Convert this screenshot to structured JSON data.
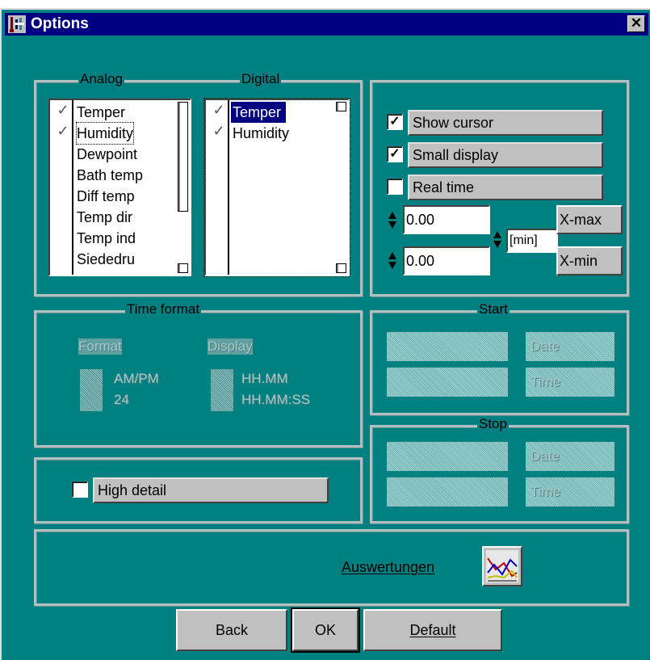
{
  "window": {
    "title": "Options",
    "close_label": "✕"
  },
  "analog": {
    "legend": "Analog",
    "items": [
      {
        "label": "Temper",
        "checked": true
      },
      {
        "label": "Humidity",
        "checked": true
      },
      {
        "label": "Dewpoint",
        "checked": false
      },
      {
        "label": "Bath temp",
        "checked": false
      },
      {
        "label": "Diff temp",
        "checked": false
      },
      {
        "label": "Temp dir",
        "checked": false
      },
      {
        "label": "Temp ind",
        "checked": false
      },
      {
        "label": "Siededru",
        "checked": false
      }
    ],
    "check_glyph": "✓"
  },
  "digital": {
    "legend": "Digital",
    "items": [
      {
        "label": "Temper",
        "checked": true,
        "selected": true
      },
      {
        "label": "Humidity",
        "checked": true,
        "selected": false
      }
    ],
    "check_glyph": "✓"
  },
  "display": {
    "show_cursor": {
      "label": "Show cursor",
      "checked": true
    },
    "small_display": {
      "label": "Small display",
      "checked": true
    },
    "real_time": {
      "label": "Real time",
      "checked": false
    },
    "x_max_value": "0.00",
    "x_min_value": "0.00",
    "unit": "[min]",
    "x_max_label": "X-max",
    "x_min_label": "X-min",
    "check_glyph": "✓"
  },
  "time_format": {
    "legend": "Time format",
    "format_label": "Format",
    "display_label": "Display",
    "format_options": [
      "AM/PM",
      "24"
    ],
    "display_options": [
      "HH.MM",
      "HH.MM:SS"
    ]
  },
  "start": {
    "legend": "Start",
    "date_label": "Date",
    "time_label": "Time"
  },
  "stop": {
    "legend": "Stop",
    "date_label": "Date",
    "time_label": "Time"
  },
  "high_detail": {
    "label": "High detail",
    "checked": false
  },
  "auswertungen": {
    "label": "Auswertungen",
    "icon": "chart-icon"
  },
  "buttons": {
    "back": "Back",
    "ok": "OK",
    "default": "Default"
  },
  "colors": {
    "background": "#008080",
    "titlebar": "#000080",
    "face": "#c0c0c0"
  }
}
